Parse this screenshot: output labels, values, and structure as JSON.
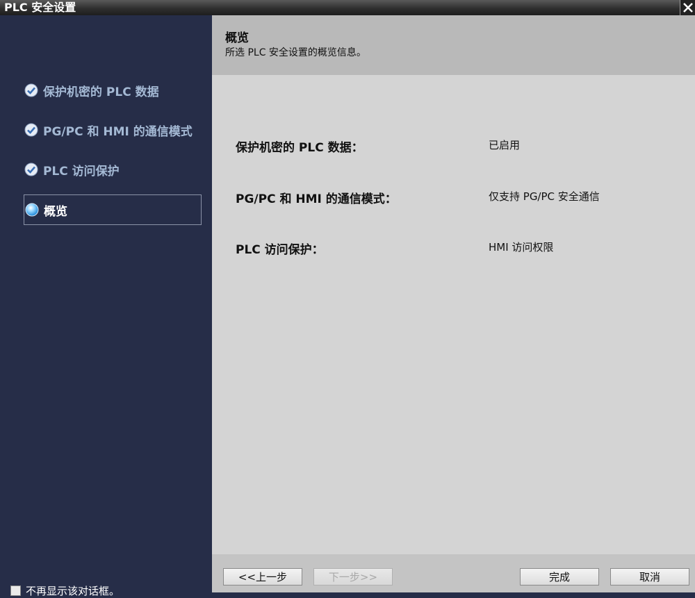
{
  "window": {
    "title": "PLC 安全设置"
  },
  "sidebar": {
    "items": [
      {
        "label": "保护机密的 PLC 数据",
        "state": "completed",
        "icon": "check-circle-icon"
      },
      {
        "label": "PG/PC 和 HMI 的通信模式",
        "state": "completed",
        "icon": "check-circle-icon"
      },
      {
        "label": "PLC 访问保护",
        "state": "completed",
        "icon": "check-circle-icon"
      },
      {
        "label": "概览",
        "state": "active",
        "icon": "current-step-bullet-icon"
      }
    ],
    "dont_show_again_label": "不再显示该对话框。",
    "dont_show_again_checked": false
  },
  "header": {
    "title": "概览",
    "subtitle": "所选 PLC 安全设置的概览信息。"
  },
  "summary": {
    "rows": [
      {
        "label": "保护机密的 PLC 数据：",
        "value": "已启用"
      },
      {
        "label": "PG/PC 和 HMI 的通信模式：",
        "value": "仅支持 PG/PC 安全通信"
      },
      {
        "label": "PLC 访问保护：",
        "value": "HMI 访问权限"
      }
    ]
  },
  "footer": {
    "back_label": "<<上一步",
    "next_label": "下一步>>",
    "finish_label": "完成",
    "cancel_label": "取消"
  },
  "colors": {
    "sidebar_bg": "#262d48",
    "sidebar_text": "#a4b9d4",
    "content_bg": "#d4d4d4",
    "header_bg": "#b9b9b9"
  }
}
